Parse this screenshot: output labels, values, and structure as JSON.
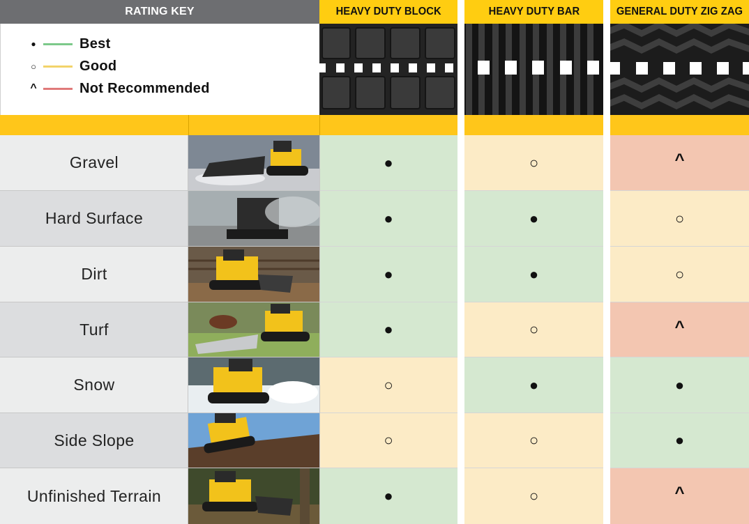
{
  "header": {
    "rating_key": "RATING KEY",
    "columns": [
      "HEAVY DUTY BLOCK",
      "HEAVY DUTY BAR",
      "GENERAL DUTY ZIG ZAG"
    ]
  },
  "legend": [
    {
      "symbol": "●",
      "label": "Best",
      "color": "#7cc98a"
    },
    {
      "symbol": "○",
      "label": "Good",
      "color": "#f2d36a"
    },
    {
      "symbol": "^",
      "label": "Not Recommended",
      "color": "#e07a7a"
    }
  ],
  "colors": {
    "best_bg": "#d5e8d0",
    "good_bg": "#fcebc6",
    "not_recommended_bg": "#f3c6b1",
    "accent_yellow": "#ffcd11",
    "header_gray": "#6d6e71"
  },
  "rows": [
    {
      "terrain": "Gravel",
      "ratings": [
        "best",
        "good",
        "not_recommended"
      ]
    },
    {
      "terrain": "Hard Surface",
      "ratings": [
        "best",
        "best",
        "good"
      ]
    },
    {
      "terrain": "Dirt",
      "ratings": [
        "best",
        "best",
        "good"
      ]
    },
    {
      "terrain": "Turf",
      "ratings": [
        "best",
        "good",
        "not_recommended"
      ]
    },
    {
      "terrain": "Snow",
      "ratings": [
        "good",
        "best",
        "best"
      ]
    },
    {
      "terrain": "Side Slope",
      "ratings": [
        "good",
        "good",
        "best"
      ]
    },
    {
      "terrain": "Unfinished Terrain",
      "ratings": [
        "best",
        "good",
        "not_recommended"
      ]
    }
  ],
  "symbols": {
    "best": "●",
    "good": "○",
    "not_recommended": "^"
  }
}
